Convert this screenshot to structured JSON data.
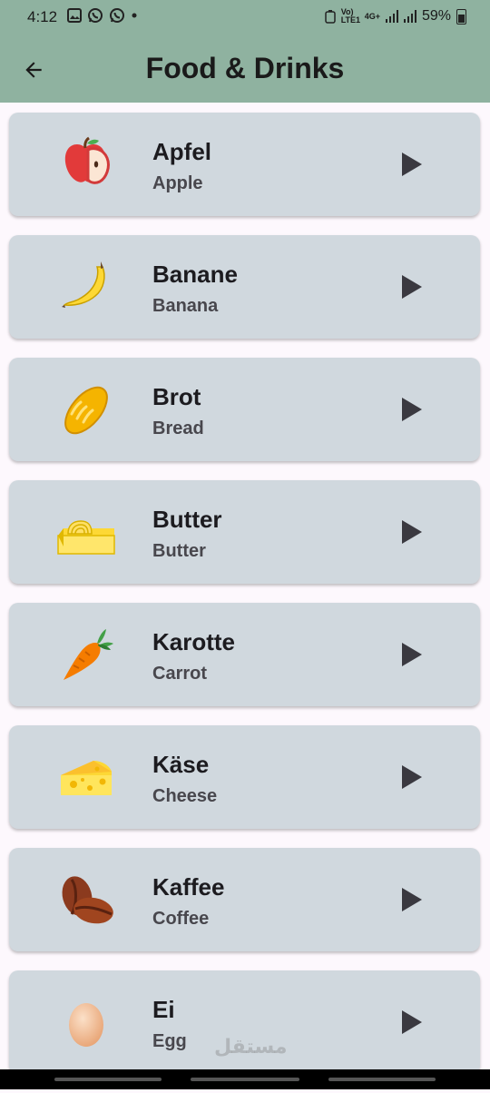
{
  "status": {
    "time": "4:12",
    "carrier_small": "Vo) LTE1",
    "network": "4G+",
    "battery": "59%"
  },
  "appbar": {
    "title": "Food & Drinks"
  },
  "items": [
    {
      "german": "Apfel",
      "english": "Apple",
      "icon": "apple-icon"
    },
    {
      "german": "Banane",
      "english": "Banana",
      "icon": "banana-icon"
    },
    {
      "german": "Brot",
      "english": "Bread",
      "icon": "bread-icon"
    },
    {
      "german": "Butter",
      "english": "Butter",
      "icon": "butter-icon"
    },
    {
      "german": "Karotte",
      "english": "Carrot",
      "icon": "carrot-icon"
    },
    {
      "german": "Käse",
      "english": "Cheese",
      "icon": "cheese-icon"
    },
    {
      "german": "Kaffee",
      "english": "Coffee",
      "icon": "coffee-icon"
    },
    {
      "german": "Ei",
      "english": "Egg",
      "icon": "egg-icon"
    }
  ],
  "watermark": "مستقل",
  "colors": {
    "appbar": "#8fb2a0",
    "card": "#d0d8de",
    "background": "#fdf8fd",
    "play": "#3a3940"
  }
}
